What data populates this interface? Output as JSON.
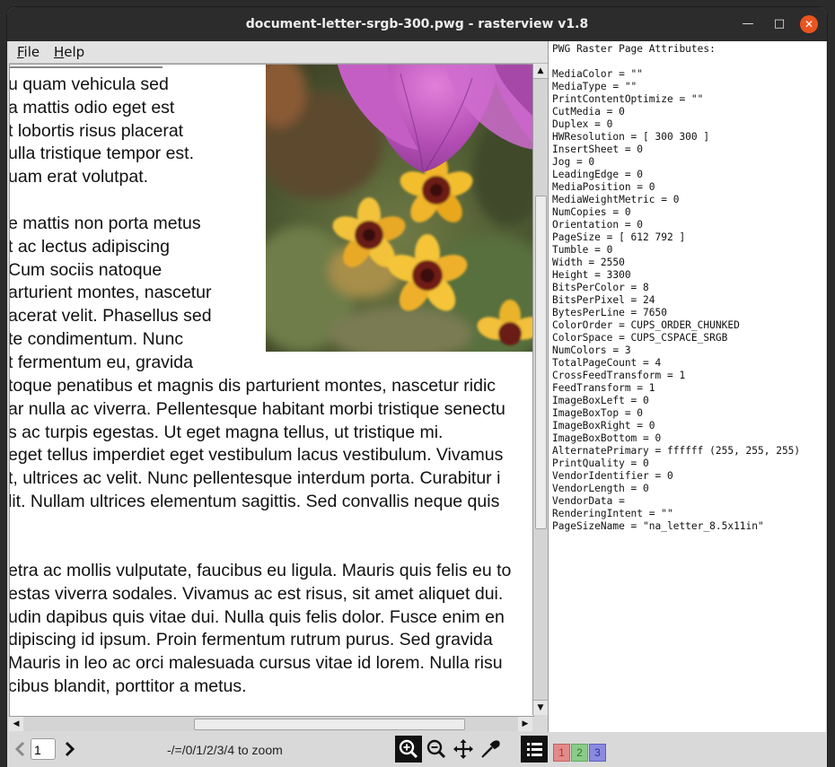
{
  "window": {
    "title": "document-letter-srgb-300.pwg - rasterview v1.8",
    "minimize_glyph": "—",
    "maximize_glyph": "□",
    "close_glyph": "✕"
  },
  "menu": {
    "file_label": "File",
    "file_mnemonic": "F",
    "file_rest": "ile",
    "help_mnemonic": "H",
    "help_rest": "elp"
  },
  "document": {
    "lines_top": [
      "u quam vehicula sed",
      "a mattis odio eget est",
      "t lobortis risus placerat",
      "ulla tristique tempor est.",
      "uam erat volutpat."
    ],
    "lines_mid": [
      "e mattis non porta metus",
      "t ac lectus adipiscing",
      "Cum sociis natoque",
      "arturient montes, nascetur",
      "acerat velit. Phasellus sed",
      "te condimentum. Nunc",
      "t fermentum eu, gravida"
    ],
    "lines_wide": [
      "toque penatibus et magnis dis parturient montes, nascetur ridic",
      "ar nulla ac viverra. Pellentesque habitant morbi tristique senectu",
      "s ac turpis egestas. Ut eget magna tellus, ut tristique mi.",
      "eget tellus imperdiet eget vestibulum lacus vestibulum. Vivamus",
      "t, ultrices ac velit. Nunc pellentesque interdum porta. Curabitur i",
      "lit. Nullam ultrices elementum sagittis. Sed convallis neque quis"
    ],
    "lines_bottom": [
      "etra ac mollis vulputate, faucibus eu ligula. Mauris quis felis eu to",
      "estas viverra sodales. Vivamus ac est risus, sit amet aliquet dui.",
      "udin dapibus quis vitae dui. Nulla quis felis dolor. Fusce enim en",
      "dipiscing id ipsum. Proin fermentum rutrum purus. Sed gravida",
      "Mauris in leo ac orci malesuada cursus vitae id lorem. Nulla risu",
      "cibus blandit, porttitor a metus."
    ]
  },
  "attributes_text": "PWG Raster Page Attributes:\n\nMediaColor = \"\"\nMediaType = \"\"\nPrintContentOptimize = \"\"\nCutMedia = 0\nDuplex = 0\nHWResolution = [ 300 300 ]\nInsertSheet = 0\nJog = 0\nLeadingEdge = 0\nMediaPosition = 0\nMediaWeightMetric = 0\nNumCopies = 0\nOrientation = 0\nPageSize = [ 612 792 ]\nTumble = 0\nWidth = 2550\nHeight = 3300\nBitsPerColor = 8\nBitsPerPixel = 24\nBytesPerLine = 7650\nColorOrder = CUPS_ORDER_CHUNKED\nColorSpace = CUPS_CSPACE_SRGB\nNumColors = 3\nTotalPageCount = 4\nCrossFeedTransform = 1\nFeedTransform = 1\nImageBoxLeft = 0\nImageBoxTop = 0\nImageBoxRight = 0\nImageBoxBottom = 0\nAlternatePrimary = ffffff (255, 255, 255)\nPrintQuality = 0\nVendorIdentifier = 0\nVendorLength = 0\nVendorData =\nRenderingIntent = \"\"\nPageSizeName = \"na_letter_8.5x11in\"",
  "toolbar": {
    "page_value": "1",
    "zoom_hint": "-/=/0/1/2/3/4 to zoom",
    "channels": [
      "1",
      "2",
      "3"
    ],
    "icons": [
      "prev-page-icon",
      "next-page-icon",
      "zoom-in-icon",
      "zoom-out-icon",
      "move-icon",
      "eyedropper-icon",
      "list-icon"
    ]
  },
  "colors": {
    "titlebar": "#2c2c2c",
    "close": "#e95420",
    "channel_1": "#e38a8a",
    "channel_2": "#8acb8a",
    "channel_3": "#8a8ae0"
  }
}
